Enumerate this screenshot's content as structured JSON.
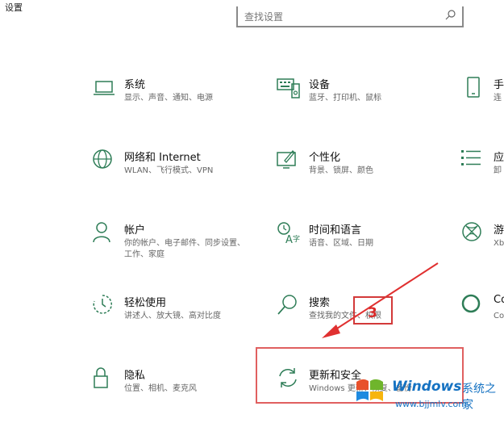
{
  "window": {
    "title": "设置"
  },
  "search": {
    "placeholder": "查找设置"
  },
  "tiles": [
    {
      "title": "系统",
      "desc": "显示、声音、通知、电源",
      "icon": "laptop-icon"
    },
    {
      "title": "设备",
      "desc": "蓝牙、打印机、鼠标",
      "icon": "keyboard-icon"
    },
    {
      "title": "手",
      "desc": "连",
      "icon": "phone-icon"
    },
    {
      "title": "网络和 Internet",
      "desc": "WLAN、飞行模式、VPN",
      "icon": "globe-icon"
    },
    {
      "title": "个性化",
      "desc": "背景、锁屏、颜色",
      "icon": "paint-icon"
    },
    {
      "title": "应",
      "desc": "卸",
      "icon": "apps-icon"
    },
    {
      "title": "帐户",
      "desc": "你的帐户、电子邮件、同步设置、工作、家庭",
      "icon": "person-icon"
    },
    {
      "title": "时间和语言",
      "desc": "语音、区域、日期",
      "icon": "time-language-icon"
    },
    {
      "title": "游",
      "desc": "Xb",
      "icon": "xbox-icon"
    },
    {
      "title": "轻松使用",
      "desc": "讲述人、放大镜、高对比度",
      "icon": "ease-of-access-icon"
    },
    {
      "title": "搜索",
      "desc": "查找我的文件、权限",
      "icon": "search-icon"
    },
    {
      "title": "Co",
      "desc": "Co",
      "icon": "cortana-icon"
    },
    {
      "title": "隐私",
      "desc": "位置、相机、麦克风",
      "icon": "lock-icon"
    },
    {
      "title": "更新和安全",
      "desc": "Windows 更新、恢复、备份",
      "icon": "sync-icon"
    }
  ],
  "annotation": {
    "step_number": "3",
    "color": "#d92b2b"
  },
  "watermark": {
    "brand": "Windows",
    "brand_suffix": "系统之家",
    "url": "www.bjjmlv.com"
  },
  "colors": {
    "accent": "#2e7d57"
  }
}
